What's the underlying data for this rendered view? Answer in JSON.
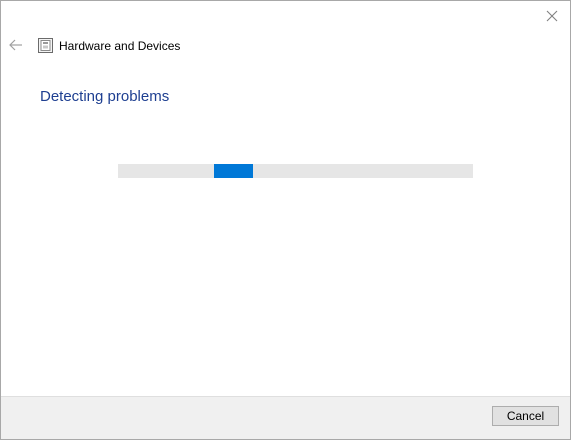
{
  "window": {
    "title": "Hardware and Devices",
    "close_icon": "close-icon",
    "back_icon": "back-arrow-icon",
    "app_icon": "hardware-devices-icon"
  },
  "main": {
    "heading": "Detecting problems",
    "progress": {
      "mode": "indeterminate",
      "fraction_position": 0.27,
      "color": "#0078d7",
      "track_color": "#e6e6e6"
    }
  },
  "footer": {
    "cancel_label": "Cancel"
  },
  "colors": {
    "heading": "#1e3f91",
    "accent": "#0078d7"
  }
}
